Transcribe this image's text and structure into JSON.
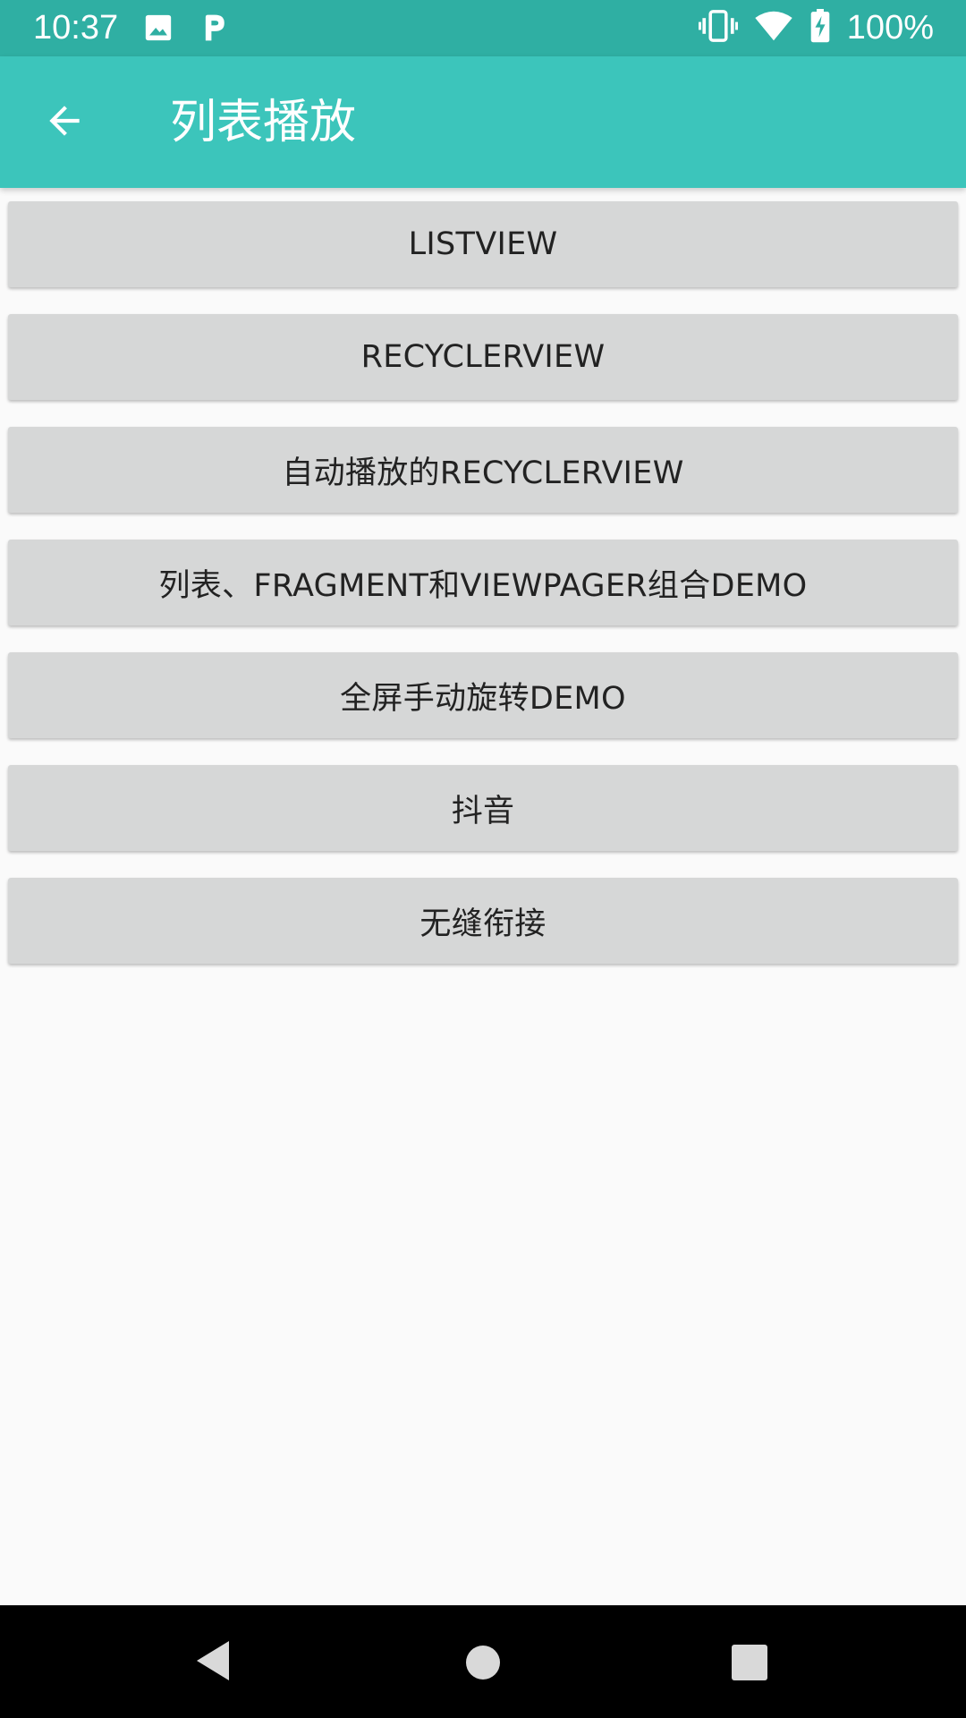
{
  "status_bar": {
    "time": "10:37",
    "battery_percent": "100%",
    "icons": [
      "image-icon",
      "p-notification-icon",
      "vibrate-icon",
      "wifi-icon",
      "battery-charging-icon"
    ],
    "background_color": "#2fafa3"
  },
  "app_bar": {
    "title": "列表播放",
    "back_icon": "arrow-left-icon",
    "background_color": "#3cc5bb"
  },
  "buttons": [
    {
      "label": "LISTVIEW"
    },
    {
      "label": "RECYCLERVIEW"
    },
    {
      "label": "自动播放的RECYCLERVIEW"
    },
    {
      "label": "列表、FRAGMENT和VIEWPAGER组合DEMO"
    },
    {
      "label": "全屏手动旋转DEMO"
    },
    {
      "label": "抖音"
    },
    {
      "label": "无缝衔接"
    }
  ],
  "nav_bar": {
    "icons": [
      "nav-back-icon",
      "nav-home-icon",
      "nav-recent-icon"
    ]
  }
}
